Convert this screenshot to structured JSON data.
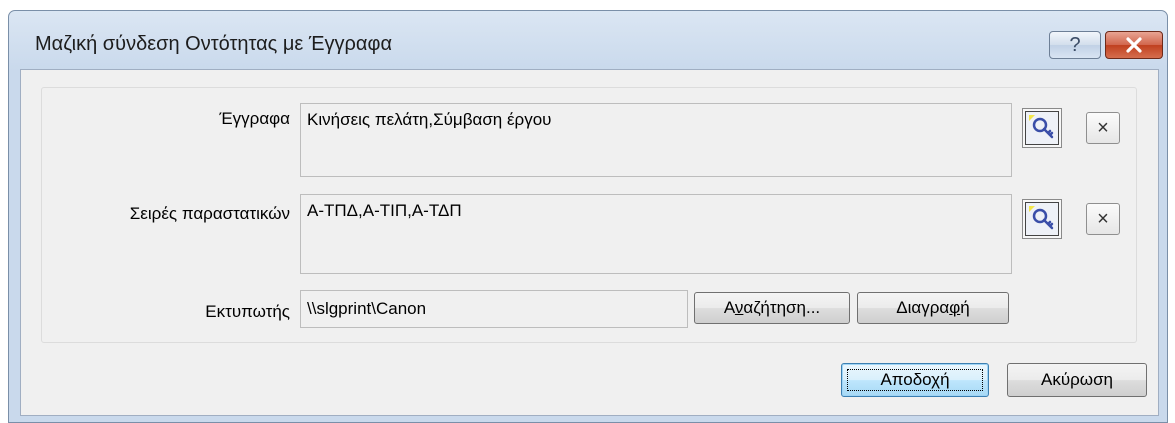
{
  "window": {
    "title": "Μαζική σύνδεση Οντότητας με Έγγραφα",
    "help_label": "?",
    "close_label": "✕"
  },
  "form": {
    "documents": {
      "label": "Έγγραφα",
      "value": "Κινήσεις πελάτη,Σύμβαση έργου",
      "clear_label": "×",
      "lookup_icon": "key-search-icon"
    },
    "series": {
      "label": "Σειρές παραστατικών",
      "value": "Α-ΤΠΔ,Α-ΤΙΠ,Α-ΤΔΠ",
      "clear_label": "×",
      "lookup_icon": "key-search-icon"
    },
    "printer": {
      "label": "Εκτυπωτής",
      "value": "\\\\slgprint\\Canon",
      "search_prefix": "Α",
      "search_mnemonic": "ν",
      "search_suffix": "αζήτηση...",
      "delete_prefix": "Διαγρα",
      "delete_mnemonic": "φ",
      "delete_suffix": "ή"
    }
  },
  "footer": {
    "ok_label": "Αποδοχή",
    "cancel_label": "Ακύρωση"
  },
  "colors": {
    "accent": "#3c7fb1",
    "close_red": "#c0401f"
  }
}
